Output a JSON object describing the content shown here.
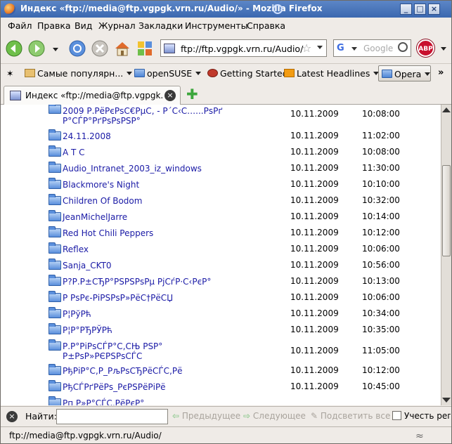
{
  "window": {
    "title": "Индекс «ftp://media@ftp.vgpgk.vrn.ru/Audio/» - Mozilla Firefox"
  },
  "menu": [
    "Файл",
    "Правка",
    "Вид",
    "Журнал",
    "Закладки",
    "Инструменты",
    "Справка"
  ],
  "navbar": {
    "url": "ftp://ftp.vgpgk.vrn.ru/Audio/",
    "search_placeholder": "Google",
    "adblock_label": "ABP"
  },
  "bookmarks": [
    {
      "label": "Самые популярн..."
    },
    {
      "label": "openSUSE"
    },
    {
      "label": "Getting Started"
    },
    {
      "label": "Latest Headlines"
    },
    {
      "label": "Opera"
    }
  ],
  "tab": {
    "title": "Индекс «ftp://media@ftp.vgpgk.vr..."
  },
  "listing": [
    {
      "name": "2009 Р.РёРєРѕС€РµС‚ - Р´С‹С…...РѕРґ Р°СЃР°РґРѕРѕРЅР°",
      "name2": "",
      "date": "10.11.2009",
      "time": "10:08:00"
    },
    {
      "name": "24.11.2008",
      "date": "10.11.2009",
      "time": "11:02:00"
    },
    {
      "name": "A T C",
      "date": "10.11.2009",
      "time": "10:08:00"
    },
    {
      "name": "Audio_Intranet_2003_iz_windows",
      "date": "10.11.2009",
      "time": "11:30:00"
    },
    {
      "name": "Blackmore's Night",
      "date": "10.11.2009",
      "time": "10:10:00"
    },
    {
      "name": "Children Of Bodom",
      "date": "10.11.2009",
      "time": "10:32:00"
    },
    {
      "name": "JeanMichelJarre",
      "date": "10.11.2009",
      "time": "10:14:00"
    },
    {
      "name": "Red Hot Chili Peppers",
      "date": "10.11.2009",
      "time": "10:12:00"
    },
    {
      "name": "Reflex",
      "date": "10.11.2009",
      "time": "10:06:00"
    },
    {
      "name": "Sanja_CKT0",
      "date": "10.11.2009",
      "time": "10:56:00"
    },
    {
      "name": "Р?Р.Р±СЂР°РЅРЅРѕРµ РјСѓР·С‹РєР°",
      "date": "10.11.2009",
      "time": "10:13:00"
    },
    {
      "name": "Р РѕРє-РіРЅРѕР»РёС†РёСЏ",
      "date": "10.11.2009",
      "time": "10:06:00"
    },
    {
      "name": "Р¦РўРћ",
      "date": "10.11.2009",
      "time": "10:34:00"
    },
    {
      "name": "Р¦Р°РЂРЎРћ",
      "date": "10.11.2009",
      "time": "10:35:00"
    },
    {
      "name": "Р.Р°РіРѕСЃР°С‚СЊ РЅР°",
      "name2": "Р±РѕР»РЄРЅРѕСЃС",
      "date": "10.11.2009",
      "time": "11:05:00"
    },
    {
      "name": "РђРіР°С‚Р_РљРѕСЂРёСЃС‚Рё",
      "date": "10.11.2009",
      "time": "10:12:00"
    },
    {
      "name": "РђСЃРґРёРѕ_РєРЅРёРіРё",
      "date": "10.11.2009",
      "time": "10:45:00"
    },
    {
      "name": "Рп Р»Р°СЃС‚РёРєР°",
      "date": "",
      "time": ""
    }
  ],
  "findbar": {
    "label": "Найти:",
    "prev": "Предыдущее",
    "next": "Следующее",
    "highlight": "Подсветить все",
    "match_case": "Учесть реги"
  },
  "status": {
    "text": "ftp://media@ftp.vgpgk.vrn.ru/Audio/"
  }
}
